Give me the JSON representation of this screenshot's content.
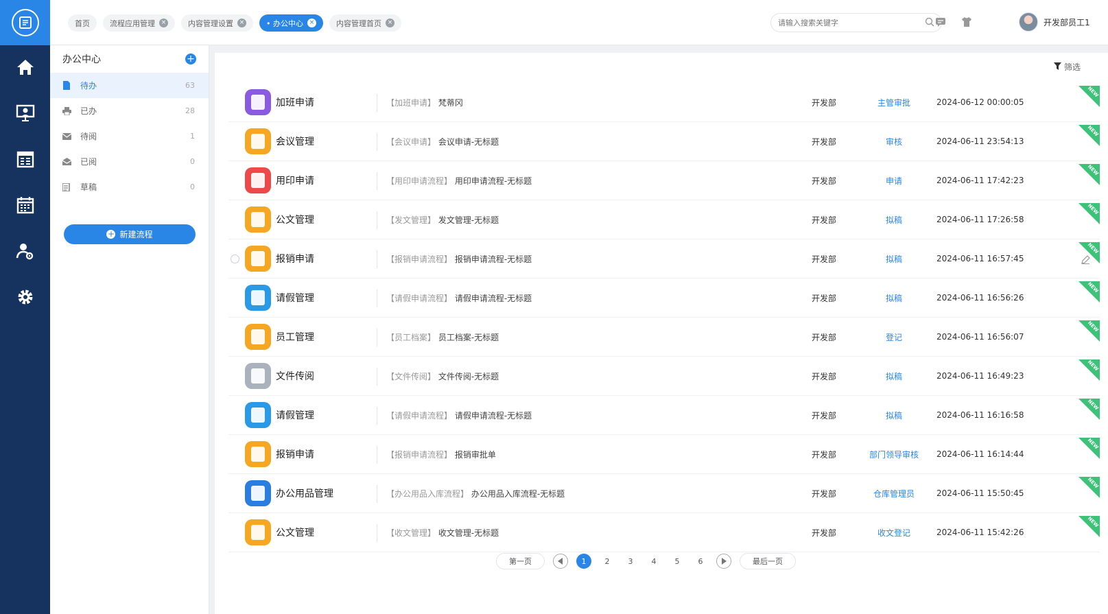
{
  "rail": {
    "items": [
      {
        "icon": "home-icon"
      },
      {
        "icon": "presentation-icon"
      },
      {
        "icon": "calendar-grid-icon"
      },
      {
        "icon": "calendar-icon"
      },
      {
        "icon": "user-settings-icon"
      },
      {
        "icon": "gear-icon"
      }
    ]
  },
  "tabs": [
    {
      "label": "首页",
      "closable": false,
      "active": false
    },
    {
      "label": "流程应用管理",
      "closable": true,
      "active": false
    },
    {
      "label": "内容管理设置",
      "closable": true,
      "active": false
    },
    {
      "label": "• 办公中心",
      "closable": true,
      "active": true
    },
    {
      "label": "内容管理首页",
      "closable": true,
      "active": false
    }
  ],
  "search": {
    "placeholder": "请输入搜索关键字"
  },
  "user": {
    "name": "开发部员工1"
  },
  "sidebar": {
    "title": "办公中心",
    "items": [
      {
        "label": "待办",
        "count": "63",
        "icon": "document-icon",
        "active": true
      },
      {
        "label": "已办",
        "count": "28",
        "icon": "printer-icon",
        "active": false
      },
      {
        "label": "待阅",
        "count": "1",
        "icon": "mail-icon",
        "active": false
      },
      {
        "label": "已阅",
        "count": "0",
        "icon": "open-mail-icon",
        "active": false
      },
      {
        "label": "草稿",
        "count": "0",
        "icon": "draft-icon",
        "active": false
      }
    ],
    "new_flow_label": "新建流程"
  },
  "filter_label": "筛选",
  "rows": [
    {
      "app": "加班申请",
      "color": "#8a5be0",
      "tag": "【加班申请】",
      "title": "梵蒂冈",
      "dept": "开发部",
      "node": "主管审批",
      "time": "2024-06-12 00:00:05"
    },
    {
      "app": "会议管理",
      "color": "#f5a623",
      "tag": "【会议申请】",
      "title": "会议申请-无标题",
      "dept": "开发部",
      "node": "审核",
      "time": "2024-06-11 23:54:13"
    },
    {
      "app": "用印申请",
      "color": "#ec4a4a",
      "tag": "【用印申请流程】",
      "title": "用印申请流程-无标题",
      "dept": "开发部",
      "node": "申请",
      "time": "2024-06-11 17:42:23"
    },
    {
      "app": "公文管理",
      "color": "#f5a623",
      "tag": "【发文管理】",
      "title": "发文管理-无标题",
      "dept": "开发部",
      "node": "拟稿",
      "time": "2024-06-11 17:26:58"
    },
    {
      "app": "报销申请",
      "color": "#f5a623",
      "tag": "【报销申请流程】",
      "title": "报销申请流程-无标题",
      "dept": "开发部",
      "node": "拟稿",
      "time": "2024-06-11 16:57:45"
    },
    {
      "app": "请假管理",
      "color": "#2a9ae6",
      "tag": "【请假申请流程】",
      "title": "请假申请流程-无标题",
      "dept": "开发部",
      "node": "拟稿",
      "time": "2024-06-11 16:56:26"
    },
    {
      "app": "员工管理",
      "color": "#f5a623",
      "tag": "【员工档案】",
      "title": "员工档案-无标题",
      "dept": "开发部",
      "node": "登记",
      "time": "2024-06-11 16:56:07"
    },
    {
      "app": "文件传阅",
      "color": "#aab2bd",
      "tag": "【文件传阅】",
      "title": "文件传阅-无标题",
      "dept": "开发部",
      "node": "拟稿",
      "time": "2024-06-11 16:49:23"
    },
    {
      "app": "请假管理",
      "color": "#2a9ae6",
      "tag": "【请假申请流程】",
      "title": "请假申请流程-无标题",
      "dept": "开发部",
      "node": "拟稿",
      "time": "2024-06-11 16:16:58"
    },
    {
      "app": "报销申请",
      "color": "#f5a623",
      "tag": "【报销申请流程】",
      "title": "报销审批单",
      "dept": "开发部",
      "node": "部门领导审核",
      "time": "2024-06-11 16:14:44"
    },
    {
      "app": "办公用品管理",
      "color": "#2a7ee0",
      "tag": "【办公用品入库流程】",
      "title": "办公用品入库流程-无标题",
      "dept": "开发部",
      "node": "仓库管理员",
      "time": "2024-06-11 15:50:45"
    },
    {
      "app": "公文管理",
      "color": "#f5a623",
      "tag": "【收文管理】",
      "title": "收文管理-无标题",
      "dept": "开发部",
      "node": "收文登记",
      "time": "2024-06-11 15:42:26"
    }
  ],
  "new_badge": "NEW",
  "pagination": {
    "first": "第一页",
    "last": "最后一页",
    "pages": [
      "1",
      "2",
      "3",
      "4",
      "5",
      "6"
    ],
    "current": "1"
  }
}
